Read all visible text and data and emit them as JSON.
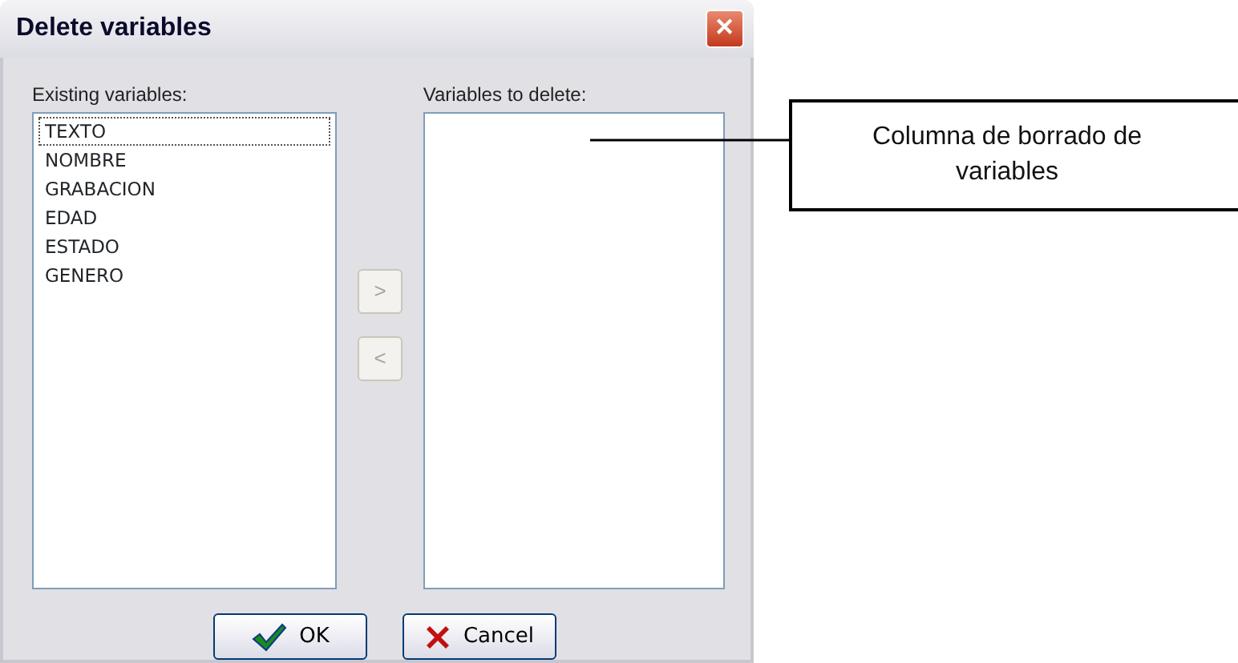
{
  "window": {
    "title": "Delete variables",
    "close": "✕"
  },
  "existing": {
    "label": "Existing variables:",
    "items": [
      {
        "text": "TEXTO",
        "focused": true
      },
      {
        "text": "NOMBRE",
        "focused": false
      },
      {
        "text": "GRABACION",
        "focused": false
      },
      {
        "text": "EDAD",
        "focused": false
      },
      {
        "text": "ESTADO",
        "focused": false
      },
      {
        "text": "GENERO",
        "focused": false
      }
    ]
  },
  "move_buttons": [
    {
      "text": ">",
      "disabled": true
    },
    {
      "text": "<",
      "disabled": true
    }
  ],
  "to_delete": {
    "label": "Variables to delete:"
  },
  "buttons": [
    {
      "kind": "ok",
      "text": "OK"
    },
    {
      "kind": "cancel",
      "text": "Cancel"
    }
  ],
  "callout": {
    "text": "Columna de borrado de variables"
  }
}
